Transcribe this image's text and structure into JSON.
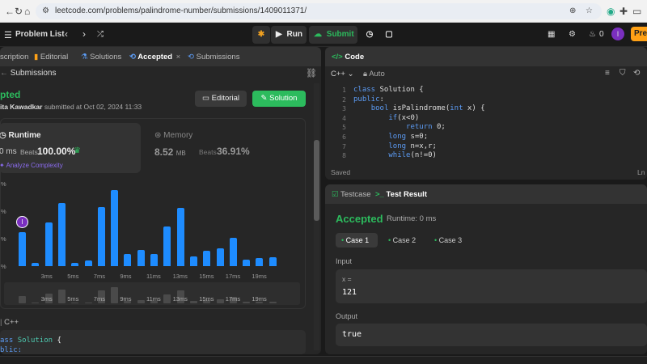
{
  "browser": {
    "url": "leetcode.com/problems/palindrome-number/submissions/1409011371/"
  },
  "nav": {
    "problem_list": "Problem List",
    "run": "Run",
    "submit": "Submit",
    "streak_count": "0",
    "avatar_letter": "I",
    "premium": "Pre"
  },
  "left": {
    "tabs": [
      "scription",
      "Editorial",
      "Solutions",
      "Accepted",
      "Submissions"
    ],
    "header": "Submissions",
    "status": "pted",
    "author": "ita Kawadkar",
    "submitted": "submitted at Oct 02, 2024 11:33",
    "editorial_btn": "Editorial",
    "solution_btn": "Solution",
    "runtime": {
      "label": "Runtime",
      "value": "0 ms",
      "beats_label": "Beats",
      "beats_value": "100.00%",
      "analyze": "Analyze Complexity"
    },
    "memory": {
      "label": "Memory",
      "value": "8.52",
      "unit": "MB",
      "beats_label": "Beats",
      "beats_value": "36.91%"
    },
    "lang": "C++",
    "code": [
      "ass Solution {",
      "blic:"
    ]
  },
  "chart_data": {
    "type": "bar",
    "x_ticks": [
      "3ms",
      "5ms",
      "7ms",
      "9ms",
      "11ms",
      "13ms",
      "15ms",
      "17ms",
      "19ms"
    ],
    "y_ticks": [
      "%",
      "%",
      "%",
      "%"
    ],
    "values": [
      31,
      3,
      40,
      57,
      3,
      5,
      54,
      69,
      11,
      15,
      11,
      36,
      53,
      9,
      14,
      16,
      26,
      6,
      7,
      8
    ],
    "ylim": [
      0,
      75
    ],
    "highlight_index": 0,
    "marker_label": "I",
    "colors": {
      "bar": "#1e8cff"
    }
  },
  "code": {
    "title": "Code",
    "lang": "C++",
    "auto": "Auto",
    "saved": "Saved",
    "position": "Ln 1",
    "line_numbers": [
      "1",
      "2",
      "3",
      "4",
      "5",
      "6",
      "7",
      "8"
    ],
    "lines": [
      "class Solution {",
      "public:",
      "    bool isPalindrome(int x) {",
      "        if(x<0)",
      "            return 0;",
      "        long s=0;",
      "        long n=x,r;",
      "        while(n!=0)"
    ]
  },
  "result": {
    "testcase_tab": "Testcase",
    "result_tab": "Test Result",
    "status": "Accepted",
    "runtime": "Runtime: 0 ms",
    "cases": [
      "Case 1",
      "Case 2",
      "Case 3"
    ],
    "input_label": "Input",
    "input_var": "x =",
    "input_value": "121",
    "output_label": "Output",
    "output_value": "true"
  }
}
